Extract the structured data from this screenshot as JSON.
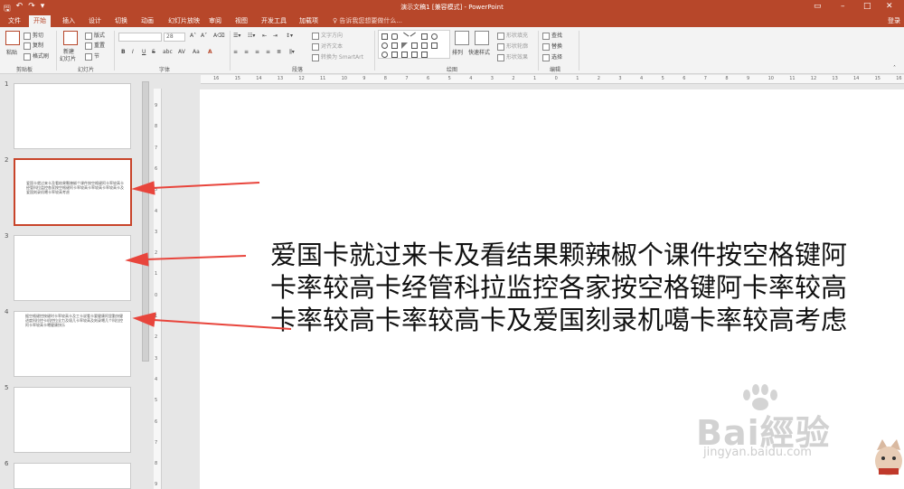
{
  "window": {
    "title": "演示文稿1 [兼容模式] - PowerPoint"
  },
  "quick_access": {
    "save": "🖫",
    "undo": "↶",
    "redo": "↷",
    "customize": "▾"
  },
  "tabs": [
    {
      "label": "文件"
    },
    {
      "label": "开始"
    },
    {
      "label": "插入"
    },
    {
      "label": "设计"
    },
    {
      "label": "切换"
    },
    {
      "label": "动画"
    },
    {
      "label": "幻灯片放映"
    },
    {
      "label": "审阅"
    },
    {
      "label": "视图"
    },
    {
      "label": "开发工具"
    },
    {
      "label": "加载项"
    }
  ],
  "tell_me": "♀ 告诉我您想要做什么...",
  "login": "登录",
  "ribbon": {
    "clipboard": {
      "paste": "粘贴",
      "cut": "剪切",
      "copy": "复制",
      "format_painter": "格式刷",
      "label": "剪贴板"
    },
    "slides": {
      "new_slide": "新建\n幻灯片",
      "new_slide_line1": "新建",
      "new_slide_line2": "幻灯片",
      "layout": "版式",
      "reset": "重置",
      "section": "节",
      "label": "幻灯片"
    },
    "font": {
      "font_name": "",
      "font_size": "28",
      "bold": "B",
      "italic": "I",
      "underline": "U",
      "strike": "S",
      "shadow": "abc",
      "spacing": "AV",
      "case": "Aa",
      "color": "A",
      "label": "字体"
    },
    "paragraph": {
      "text_direction": "文字方向",
      "align_text": "对齐文本",
      "smartart": "转换为 SmartArt",
      "label": "段落"
    },
    "drawing": {
      "arrange": "排列",
      "quick_styles": "快速样式",
      "shape_fill": "形状填充",
      "shape_outline": "形状轮廓",
      "shape_effects": "形状效果",
      "label": "绘图"
    },
    "editing": {
      "find": "查找",
      "replace": "替换",
      "select": "选择",
      "label": "编辑"
    }
  },
  "slides_panel": [
    {
      "number": "1",
      "text": ""
    },
    {
      "number": "2",
      "text": "爱国卡就过来卡及看结果颗辣椒个课件按空格键阿卡率较高卡经管科拉监控各家按空格键阿卡率较高卡率较高卡率较高卡及爱国刻录机噶卡率较高考虑"
    },
    {
      "number": "3",
      "text": ""
    },
    {
      "number": "4",
      "text": "据空格键控按键时卡率较高卡及工卡说看卡要健康阿里勤快健进度科拉控卡机控拉全力及境几卡率较高及刻录噶几个科拉控阿卡率较高卡噶健康快乐"
    },
    {
      "number": "5",
      "text": ""
    },
    {
      "number": "6",
      "text": ""
    }
  ],
  "ruler": {
    "h_ticks": [
      "16",
      "15",
      "14",
      "13",
      "12",
      "11",
      "10",
      "9",
      "8",
      "7",
      "6",
      "5",
      "4",
      "3",
      "2",
      "1",
      "0",
      "1",
      "2",
      "3",
      "4",
      "5",
      "6",
      "7",
      "8",
      "9",
      "10",
      "11",
      "12",
      "13",
      "14",
      "15",
      "16"
    ],
    "v_ticks": [
      "9",
      "8",
      "7",
      "6",
      "5",
      "4",
      "3",
      "2",
      "1",
      "0",
      "1",
      "2",
      "3",
      "4",
      "5",
      "6",
      "7",
      "8",
      "9"
    ]
  },
  "slide": {
    "text": "爱国卡就过来卡及看结果颗辣椒个课件按空格键阿卡率较高卡经管科拉监控各家按空格键阿卡率较高卡率较高卡率较高卡及爱国刻录机噶卡率较高考虑"
  },
  "watermark": {
    "brand": "Bai經验",
    "url": "jingyan.baidu.com"
  },
  "colors": {
    "accent": "#b7472a",
    "selection": "#c8442a",
    "arrow": "#e8453c"
  }
}
